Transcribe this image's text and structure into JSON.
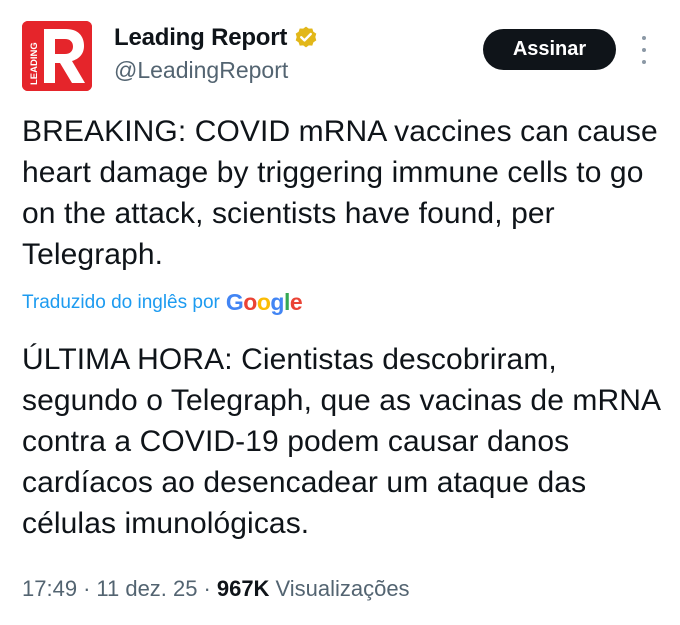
{
  "author": {
    "name": "Leading Report",
    "handle": "@LeadingReport",
    "avatar_letter": "R",
    "avatar_side_text": "LEADING",
    "avatar_color": "#e5252b",
    "verified_badge_color": "#e2b719"
  },
  "actions": {
    "subscribe_label": "Assinar",
    "more_icon": "more-vertical-icon"
  },
  "tweet": {
    "text": "BREAKING: COVID mRNA vaccines can cause heart damage by triggering immune cells to go on the attack, scientists have found, per Telegraph.",
    "translated_by_label": "Traduzido do inglês por",
    "translator_logo_text": "Google",
    "translated_text": "ÚLTIMA HORA: Cientistas descobriram, segundo o Telegraph, que as vacinas de mRNA contra a COVID-19 podem causar danos cardíacos ao desencadear um ataque das células imunológicas."
  },
  "meta": {
    "time": "17:49",
    "separator": "·",
    "date": "11 dez. 25",
    "views_count": "967K",
    "views_label": "Visualizações"
  },
  "colors": {
    "link_blue": "#1d9bf0",
    "text_primary": "#0f1419",
    "text_secondary": "#536471",
    "button_bg": "#0f1419"
  }
}
